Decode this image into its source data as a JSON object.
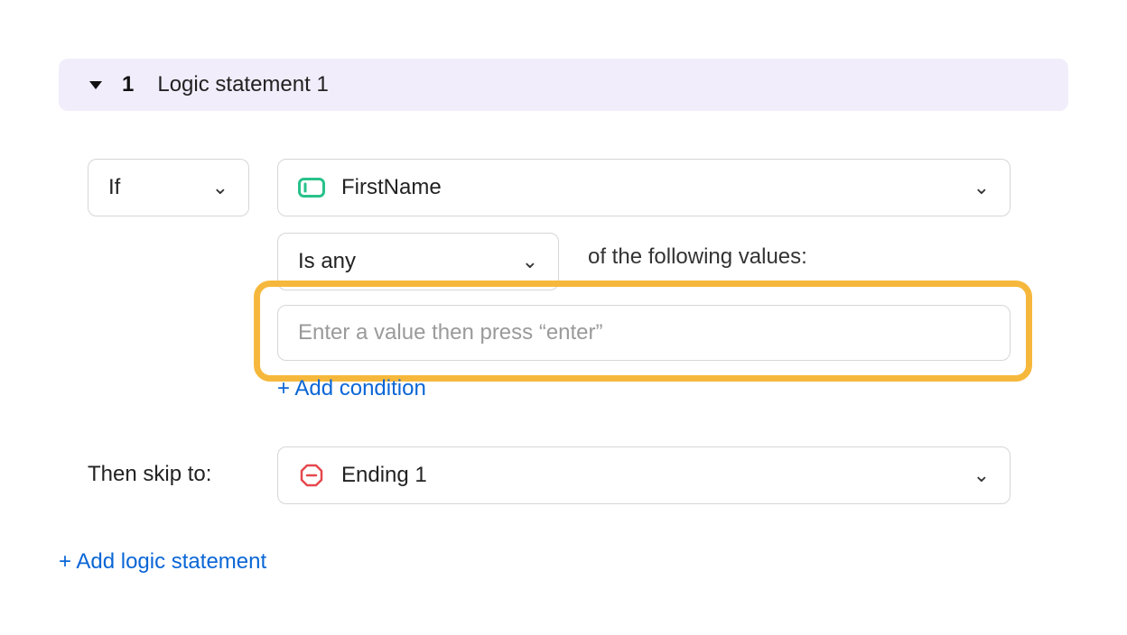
{
  "header": {
    "number": "1",
    "title": "Logic statement 1"
  },
  "condition": {
    "clause": "If",
    "field": "FirstName",
    "operator": "Is any",
    "following_text": "of the following values:",
    "value_placeholder": "Enter a value then press “enter”",
    "add_condition": "+ Add condition"
  },
  "action": {
    "then_label": "Then skip to:",
    "target": "Ending 1"
  },
  "footer": {
    "add_statement": "+ Add logic statement"
  }
}
